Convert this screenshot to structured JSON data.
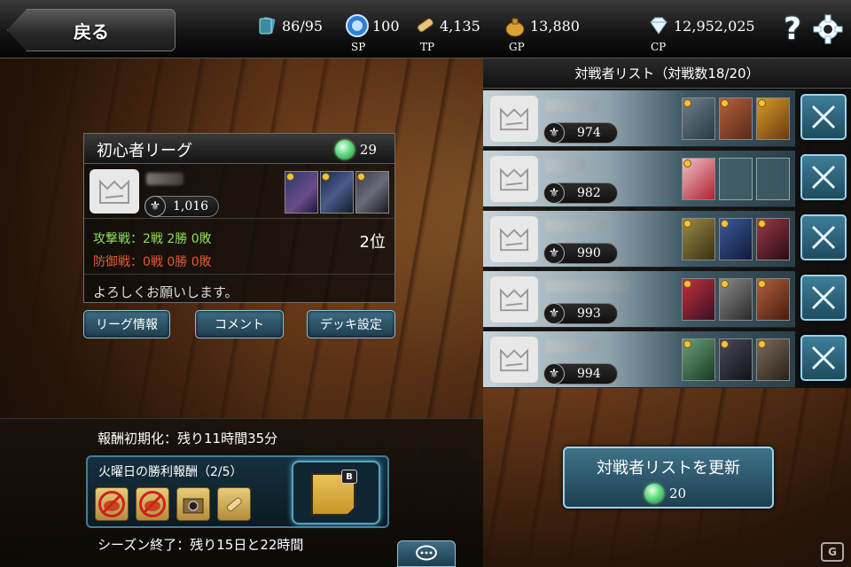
{
  "topbar": {
    "back_label": "戻る",
    "cards": "86/95",
    "sp_value": "100",
    "sp_label": "SP",
    "tp_value": "4,135",
    "tp_label": "TP",
    "gp_value": "13,880",
    "gp_label": "GP",
    "cp_value": "12,952,025",
    "cp_label": "CP",
    "help_label": "?"
  },
  "league": {
    "title": "初心者リーグ",
    "points": "29",
    "player_rating": "1,016",
    "attack_record": "攻撃戦：2戦 2勝 0敗",
    "defense_record": "防御戦：0戦 0勝 0敗",
    "rank": "2位",
    "greeting": "よろしくお願いします。",
    "buttons": {
      "info": "リーグ情報",
      "comment": "コメント",
      "deck": "デッキ設定"
    }
  },
  "reward": {
    "reset_text": "報酬初期化：残り11時間35分",
    "title": "火曜日の勝利報酬（2/5）",
    "badge": "B",
    "season_text": "シーズン終了：残り15日と22時間"
  },
  "opponents": {
    "header": "対戦者リスト（対戦数18/20）",
    "rows": [
      {
        "rating": "974"
      },
      {
        "rating": "982"
      },
      {
        "rating": "990"
      },
      {
        "rating": "993"
      },
      {
        "rating": "994"
      }
    ],
    "refresh_label": "対戦者リストを更新",
    "refresh_cost": "20"
  },
  "watermark": "G",
  "colors": {
    "accent": "#3f7e99",
    "attack": "#8ee05a",
    "defense": "#e05a3a",
    "gem": "#6ee08a"
  }
}
